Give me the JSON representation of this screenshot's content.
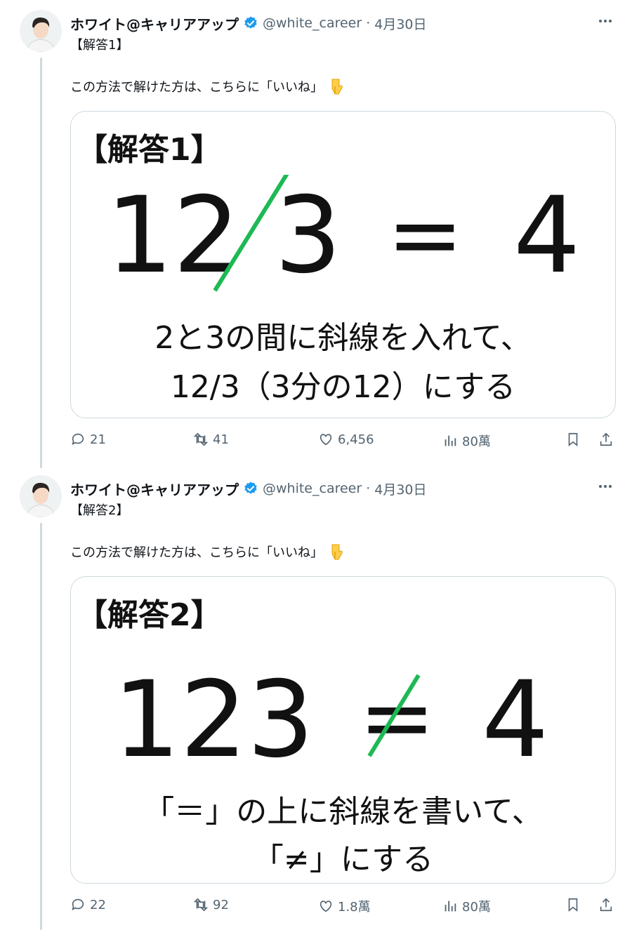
{
  "tweets": [
    {
      "display_name": "ホワイト@キャリアアップ",
      "handle": "@white_career",
      "date": "4月30日",
      "tag": "【解答1】",
      "body": "この方法で解けた方は、こちらに「いいね」",
      "card": {
        "title": "【解答1】",
        "equation_left": "12",
        "equation_right": "3",
        "equation_op": "=",
        "equation_result": "4",
        "caption_line1": "2と3の間に斜線を入れて、",
        "caption_line2": "12/3（3分の12）にする"
      },
      "actions": {
        "replies": "21",
        "retweets": "41",
        "likes": "6,456",
        "views": "80萬"
      }
    },
    {
      "display_name": "ホワイト@キャリアアップ",
      "handle": "@white_career",
      "date": "4月30日",
      "tag": "【解答2】",
      "body": "この方法で解けた方は、こちらに「いいね」",
      "card": {
        "title": "【解答2】",
        "equation_number": "123",
        "equation_op": "=",
        "equation_result": "4",
        "caption_line1": "「＝」の上に斜線を書いて、",
        "caption_line2": "「≠」にする"
      },
      "actions": {
        "replies": "22",
        "retweets": "92",
        "likes": "1.8萬",
        "views": "80萬"
      }
    }
  ],
  "colors": {
    "verified": "#1d9bf0",
    "slash": "#1db954",
    "meta": "#536471",
    "border": "#cfd9de"
  },
  "icons": [
    "avatar",
    "verified-badge-icon",
    "more-icon",
    "pointing-down-icon",
    "reply-icon",
    "retweet-icon",
    "like-icon",
    "views-icon",
    "bookmark-icon",
    "share-icon"
  ]
}
